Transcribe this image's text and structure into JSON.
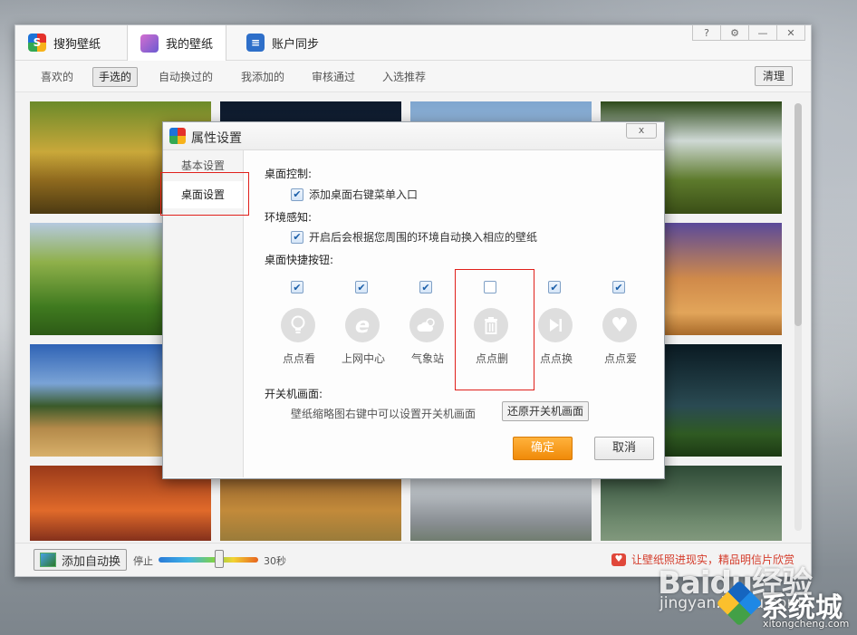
{
  "main_tabs": [
    {
      "label": "搜狗壁纸",
      "icon": "sogou-logo-icon"
    },
    {
      "label": "我的壁纸",
      "icon": "wallpaper-icon"
    },
    {
      "label": "账户同步",
      "icon": "account-sync-icon"
    }
  ],
  "window_controls": [
    "?",
    "⚙",
    "—",
    "✕"
  ],
  "subnav": {
    "items": [
      "喜欢的",
      "手选的",
      "自动换过的",
      "我添加的",
      "审核通过",
      "入选推荐"
    ],
    "active_index": 1,
    "clear_label": "清理"
  },
  "bottom": {
    "add_auto_label": "添加自动换",
    "speed_min_label": "停止",
    "speed_max_label": "30秒",
    "speed_value_fraction": 0.6,
    "promo_text": "让壁纸照进现实，精品明信片欣赏"
  },
  "dialog": {
    "title": "属性设置",
    "close_label": "x",
    "nav": [
      "基本设置",
      "桌面设置"
    ],
    "active_nav_index": 1,
    "sections": {
      "desktop_control": {
        "title": "桌面控制:",
        "checkbox_label": "添加桌面右键菜单入口",
        "checked": true
      },
      "env_sense": {
        "title": "环境感知:",
        "checkbox_label": "开启后会根据您周围的环境自动换入相应的壁纸",
        "checked": true
      },
      "shortcuts_title": "桌面快捷按钮:",
      "boot_title": "开关机画面:",
      "boot_hint": "壁纸缩略图右键中可以设置开关机画面",
      "restore_label": "还原开关机画面"
    },
    "shortcuts": [
      {
        "label": "点点看",
        "checked": true,
        "icon": "lightbulb-icon"
      },
      {
        "label": "上网中心",
        "checked": true,
        "icon": "ie-browser-icon"
      },
      {
        "label": "气象站",
        "checked": true,
        "icon": "weather-icon"
      },
      {
        "label": "点点删",
        "checked": false,
        "icon": "trash-icon"
      },
      {
        "label": "点点换",
        "checked": true,
        "icon": "next-icon"
      },
      {
        "label": "点点爱",
        "checked": true,
        "icon": "heart-icon"
      }
    ],
    "ok_label": "确定",
    "cancel_label": "取消"
  },
  "colors": {
    "accent_orange": "#f39a12",
    "highlight_red": "#e0201b",
    "checkbox_blue": "#1a5ea8"
  },
  "watermark": {
    "brand": "Baidu经验",
    "site": "jingyan.baidu.com",
    "xt_name": "系统城",
    "xt_url": "xitongcheng.com"
  }
}
